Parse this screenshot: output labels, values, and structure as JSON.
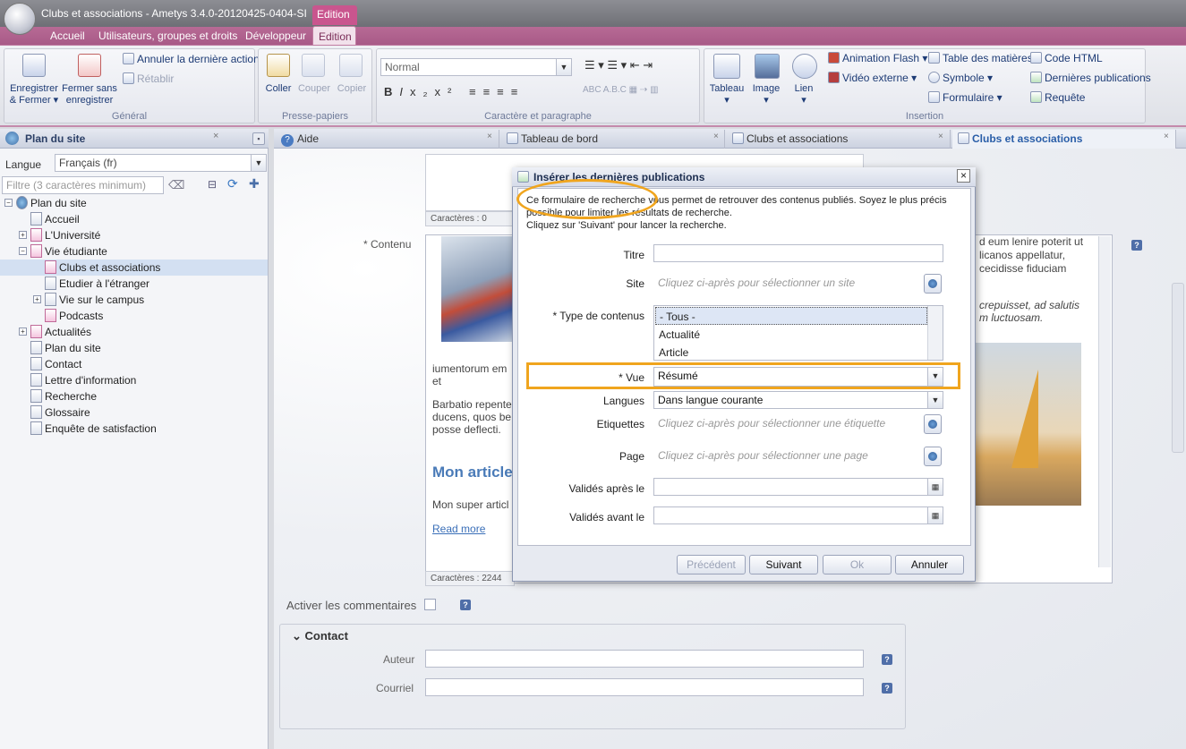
{
  "app": {
    "title": "Clubs et associations - Ametys 3.4.0-20120425-0404-SI",
    "context_tab": "Edition"
  },
  "menu_tabs": [
    "Accueil",
    "Utilisateurs, groupes et droits",
    "Développeur",
    "Edition"
  ],
  "ribbon": {
    "general": {
      "label": "Général",
      "save": "Enregistrer\n& Fermer ▾",
      "close": "Fermer sans\nenregistrer",
      "undo": "Annuler la dernière action",
      "redo": "Rétablir"
    },
    "clipboard": {
      "label": "Presse-papiers",
      "paste": "Coller",
      "cut": "Couper",
      "copy": "Copier"
    },
    "format": {
      "label": "Caractère et paragraphe",
      "style_value": "Normal"
    },
    "insert": {
      "label": "Insertion",
      "table": "Tableau",
      "image": "Image",
      "link": "Lien",
      "flash": "Animation Flash ▾",
      "video": "Vidéo externe ▾",
      "toc": "Table des matières",
      "symbol": "Symbole ▾",
      "form": "Formulaire ▾",
      "html": "Code HTML",
      "latest": "Dernières publications",
      "query": "Requête"
    }
  },
  "left": {
    "title": "Plan du site",
    "lang_label": "Langue",
    "lang_value": "Français (fr)",
    "filter_placeholder": "Filtre (3 caractères minimum)",
    "tree": [
      "Plan du site",
      "Accueil",
      "L'Université",
      "Vie étudiante",
      "Clubs et associations",
      "Etudier à l'étranger",
      "Vie sur le campus",
      "Podcasts",
      "Actualités",
      "Plan du site",
      "Contact",
      "Lettre d'information",
      "Recherche",
      "Glossaire",
      "Enquête de satisfaction"
    ]
  },
  "doc_tabs": [
    "Aide",
    "Tableau de bord",
    "Clubs et associations",
    "Clubs et associations"
  ],
  "editor": {
    "chars_top": "Caractères : 0",
    "content_label": "* Contenu",
    "chars_bottom": "Caractères : 2244",
    "para1": "iumentorum em",
    "para1b": "et",
    "para2a": "Barbatio repente",
    "para2b": "ducens, quos be",
    "para2c": "posse deflecti.",
    "heading": "Mon article",
    "para3": "Mon super articl",
    "readmore": "Read more",
    "right1": "d eum lenire poterit ut",
    "right2": "licanos appellatur,",
    "right3": "cecidisse fiduciam",
    "right4": "crepuisset, ad salutis",
    "right5": "m luctuosam."
  },
  "comments_label": "Activer les commentaires",
  "contact": {
    "title": "Contact",
    "author": "Auteur",
    "email": "Courriel"
  },
  "dialog": {
    "title": "Insérer les dernières publications",
    "intro1": "Ce formulaire de recherche vous permet de retrouver des contenus publiés. Soyez le plus précis",
    "intro2": "possible pour limiter les résultats de recherche.",
    "intro3": "Cliquez sur 'Suivant' pour lancer la recherche.",
    "titre": "Titre",
    "site": "Site",
    "site_ph": "Cliquez ci-après pour sélectionner un site",
    "type": "* Type de contenus",
    "types": [
      "- Tous -",
      "Actualité",
      "Article"
    ],
    "vue": "* Vue",
    "vue_value": "Résumé",
    "langues": "Langues",
    "langues_value": "Dans langue courante",
    "tags": "Etiquettes",
    "tags_ph": "Cliquez ci-après pour sélectionner une étiquette",
    "page": "Page",
    "page_ph": "Cliquez ci-après pour sélectionner une page",
    "after": "Validés après le",
    "before": "Validés avant le",
    "prev": "Précédent",
    "next": "Suivant",
    "ok": "Ok",
    "cancel": "Annuler"
  }
}
